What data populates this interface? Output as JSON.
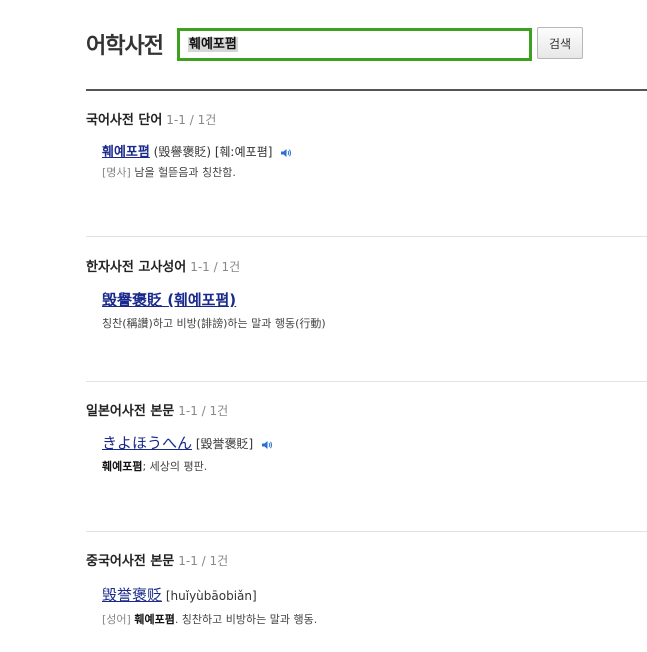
{
  "header": {
    "title": "어학사전"
  },
  "search": {
    "value": "훼예포폄",
    "button_label": "검색"
  },
  "sections": [
    {
      "title": "국어사전 단어",
      "count": "1-1 / 1건",
      "entry": {
        "word": "훼예포폄",
        "hanja": "(毁譽褒貶)",
        "pron": "[훼ː예포폄]"
      },
      "definition": {
        "pos": "[명사]",
        "text": "남을 헐뜯음과 칭찬함."
      }
    },
    {
      "title": "한자사전 고사성어",
      "count": "1-1 / 1건",
      "entry": {
        "word": "毁譽褒貶 (훼예포폄)"
      },
      "definition": {
        "text": "칭찬(稱讚)하고 비방(誹謗)하는 말과 행동(行動)"
      }
    },
    {
      "title": "일본어사전 본문",
      "count": "1-1 / 1건",
      "entry": {
        "word": "きよほうへん",
        "kanji": "[毀誉褒貶]"
      },
      "definition": {
        "bold": "훼예포폄",
        "text": "; 세상의 평판."
      }
    },
    {
      "title": "중국어사전 본문",
      "count": "1-1 / 1건",
      "entry": {
        "word": "毁誉褒贬",
        "pinyin": "[huǐyùbāobiǎn]"
      },
      "definition": {
        "pos": "[성어]",
        "bold": "훼예포폄",
        "text": ". 칭찬하고 비방하는 말과 행동."
      }
    }
  ],
  "icons": {
    "speaker": "speaker-icon"
  },
  "colors": {
    "search_border": "#3ea01f",
    "link": "#1a2a8c",
    "speaker": "#2a6fd6"
  }
}
